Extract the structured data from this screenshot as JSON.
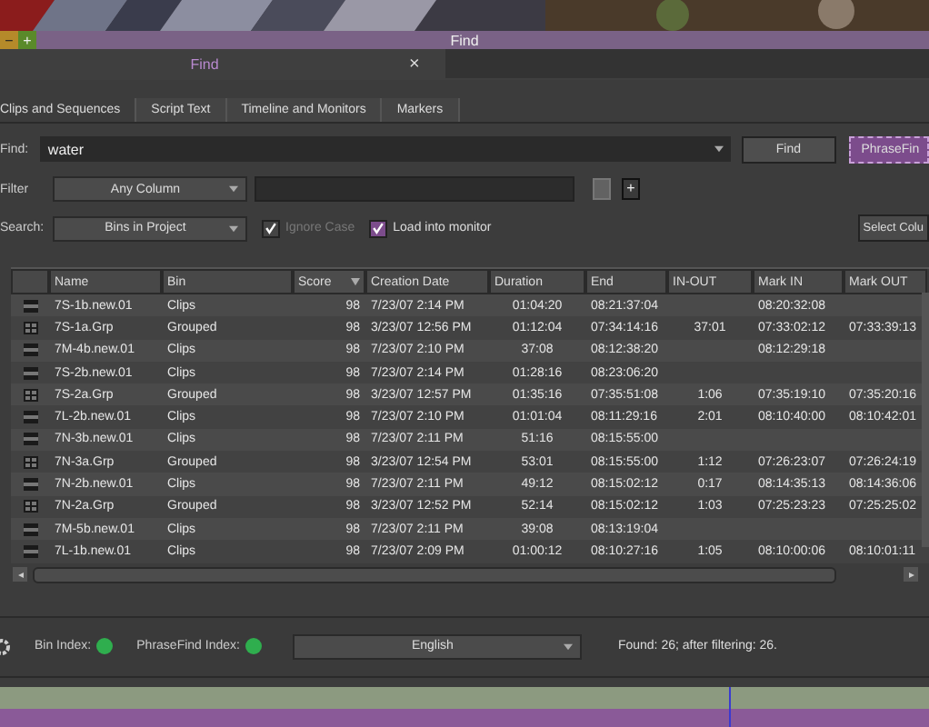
{
  "window": {
    "title": "Find",
    "controls": [
      "−",
      "+"
    ]
  },
  "panel_tab": {
    "label": "Find",
    "close": "×"
  },
  "tabs": [
    {
      "label": "Clips and Sequences",
      "selected": true
    },
    {
      "label": "Script Text",
      "selected": false
    },
    {
      "label": "Timeline and Monitors",
      "selected": false
    },
    {
      "label": "Markers",
      "selected": false
    }
  ],
  "find": {
    "label": "Find:",
    "value": "water",
    "buttons": [
      {
        "label": "Find",
        "kind": "plain"
      },
      {
        "label": "PhraseFin",
        "kind": "accent"
      }
    ]
  },
  "filter": {
    "label": "Filter",
    "dropdown": "Any Column",
    "buttons": [
      {
        "disabled": true
      },
      {
        "label": "+",
        "disabled": false
      }
    ]
  },
  "search": {
    "label": "Search:",
    "dropdown": "Bins in Project",
    "options": [
      {
        "label": "Ignore Case",
        "checked": true,
        "disabled": true
      },
      {
        "label": "Load into monitor",
        "checked": true,
        "disabled": false
      }
    ],
    "button": "Select Colu"
  },
  "table": {
    "columns": [
      {
        "label": "Name",
        "sorted": false
      },
      {
        "label": "Bin",
        "sorted": false
      },
      {
        "label": "Score",
        "sorted": true
      },
      {
        "label": "Creation Date",
        "sorted": false
      },
      {
        "label": "Duration",
        "sorted": false
      },
      {
        "label": "End",
        "sorted": false
      },
      {
        "label": "IN-OUT",
        "sorted": false
      },
      {
        "label": "Mark IN",
        "sorted": false
      },
      {
        "label": "Mark OUT",
        "sorted": false
      }
    ],
    "rows": [
      {
        "kind": "clip",
        "cells": [
          "7S-1b.new.01",
          "Clips",
          "98",
          "7/23/07 2:14 PM",
          "01:04:20",
          "08:21:37:04",
          "",
          "08:20:32:08",
          ""
        ]
      },
      {
        "kind": "group",
        "cells": [
          "7S-1a.Grp",
          "Grouped",
          "98",
          "3/23/07 12:56 PM",
          "01:12:04",
          "07:34:14:16",
          "37:01",
          "07:33:02:12",
          "07:33:39:13"
        ]
      },
      {
        "kind": "clip",
        "cells": [
          "7M-4b.new.01",
          "Clips",
          "98",
          "7/23/07 2:10 PM",
          "37:08",
          "08:12:38:20",
          "",
          "08:12:29:18",
          ""
        ]
      },
      {
        "kind": "clip",
        "cells": [
          "7S-2b.new.01",
          "Clips",
          "98",
          "7/23/07 2:14 PM",
          "01:28:16",
          "08:23:06:20",
          "",
          "",
          ""
        ]
      },
      {
        "kind": "group",
        "cells": [
          "7S-2a.Grp",
          "Grouped",
          "98",
          "3/23/07 12:57 PM",
          "01:35:16",
          "07:35:51:08",
          "1:06",
          "07:35:19:10",
          "07:35:20:16"
        ]
      },
      {
        "kind": "clip",
        "cells": [
          "7L-2b.new.01",
          "Clips",
          "98",
          "7/23/07 2:10 PM",
          "01:01:04",
          "08:11:29:16",
          "2:01",
          "08:10:40:00",
          "08:10:42:01"
        ]
      },
      {
        "kind": "clip",
        "cells": [
          "7N-3b.new.01",
          "Clips",
          "98",
          "7/23/07 2:11 PM",
          "51:16",
          "08:15:55:00",
          "",
          "",
          ""
        ]
      },
      {
        "kind": "group",
        "cells": [
          "7N-3a.Grp",
          "Grouped",
          "98",
          "3/23/07 12:54 PM",
          "53:01",
          "08:15:55:00",
          "1:12",
          "07:26:23:07",
          "07:26:24:19"
        ]
      },
      {
        "kind": "clip",
        "cells": [
          "7N-2b.new.01",
          "Clips",
          "98",
          "7/23/07 2:11 PM",
          "49:12",
          "08:15:02:12",
          "0:17",
          "08:14:35:13",
          "08:14:36:06"
        ]
      },
      {
        "kind": "group",
        "cells": [
          "7N-2a.Grp",
          "Grouped",
          "98",
          "3/23/07 12:52 PM",
          "52:14",
          "08:15:02:12",
          "1:03",
          "07:25:23:23",
          "07:25:25:02"
        ]
      },
      {
        "kind": "clip",
        "cells": [
          "7M-5b.new.01",
          "Clips",
          "98",
          "7/23/07 2:11 PM",
          "39:08",
          "08:13:19:04",
          "",
          "",
          ""
        ]
      },
      {
        "kind": "clip",
        "cells": [
          "7L-1b.new.01",
          "Clips",
          "98",
          "7/23/07 2:09 PM",
          "01:00:12",
          "08:10:27:16",
          "1:05",
          "08:10:00:06",
          "08:10:01:11"
        ]
      }
    ]
  },
  "status": {
    "indicators": [
      {
        "label": "Bin Index:",
        "color": "#2fae4e"
      },
      {
        "label": "PhraseFind Index:",
        "color": "#2fae4e"
      }
    ],
    "language": "English",
    "found": "Found: 26; after filtering: 26."
  }
}
